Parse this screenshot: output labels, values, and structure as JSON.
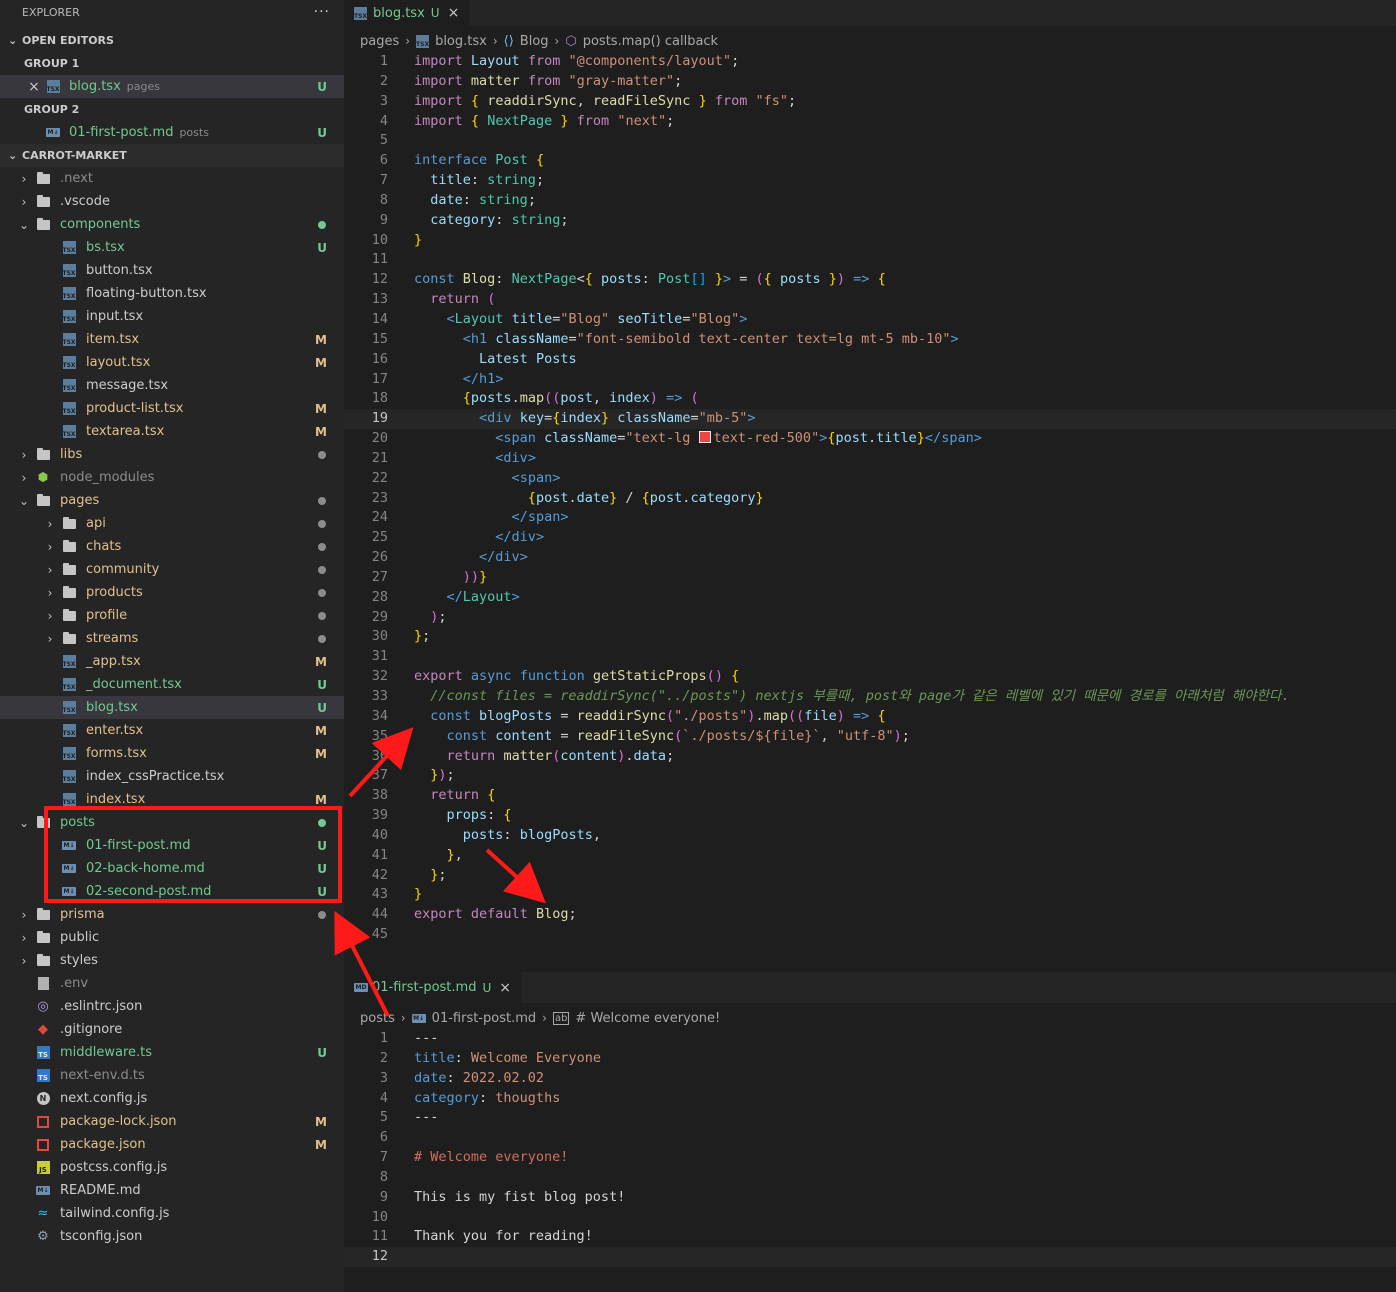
{
  "explorer": {
    "title": "EXPLORER",
    "more": "···",
    "open_editors": {
      "label": "OPEN EDITORS",
      "groups": [
        {
          "label": "GROUP 1",
          "file": "blog.tsx",
          "folder": "pages",
          "status": "U",
          "close": "×"
        },
        {
          "label": "GROUP 2",
          "file": "01-first-post.md",
          "folder": "posts",
          "status": "U"
        }
      ]
    },
    "project": {
      "label": "CARROT-MARKET"
    },
    "tree": [
      {
        "name": ".next",
        "kind": "folder",
        "depth": 0,
        "open": false,
        "color": "dim"
      },
      {
        "name": ".vscode",
        "kind": "folder",
        "depth": 0,
        "open": false,
        "color": "normal"
      },
      {
        "name": "components",
        "kind": "folder",
        "depth": 0,
        "open": true,
        "color": "u",
        "dot": "#73c991"
      },
      {
        "name": "bs.tsx",
        "kind": "tsx",
        "depth": 1,
        "color": "u",
        "status": "U"
      },
      {
        "name": "button.tsx",
        "kind": "tsx",
        "depth": 1,
        "color": "normal"
      },
      {
        "name": "floating-button.tsx",
        "kind": "tsx",
        "depth": 1,
        "color": "normal"
      },
      {
        "name": "input.tsx",
        "kind": "tsx",
        "depth": 1,
        "color": "normal"
      },
      {
        "name": "item.tsx",
        "kind": "tsx",
        "depth": 1,
        "color": "m",
        "status": "M"
      },
      {
        "name": "layout.tsx",
        "kind": "tsx",
        "depth": 1,
        "color": "m",
        "status": "M"
      },
      {
        "name": "message.tsx",
        "kind": "tsx",
        "depth": 1,
        "color": "normal"
      },
      {
        "name": "product-list.tsx",
        "kind": "tsx",
        "depth": 1,
        "color": "m",
        "status": "M"
      },
      {
        "name": "textarea.tsx",
        "kind": "tsx",
        "depth": 1,
        "color": "m",
        "status": "M"
      },
      {
        "name": "libs",
        "kind": "folder",
        "depth": 0,
        "open": false,
        "color": "m",
        "dot": "#8c8c8c"
      },
      {
        "name": "node_modules",
        "kind": "nodefolder",
        "depth": 0,
        "open": false,
        "color": "dim"
      },
      {
        "name": "pages",
        "kind": "folder",
        "depth": 0,
        "open": true,
        "color": "m",
        "dot": "#8c8c8c"
      },
      {
        "name": "api",
        "kind": "folder",
        "depth": 1,
        "open": false,
        "color": "m",
        "dot": "#8c8c8c"
      },
      {
        "name": "chats",
        "kind": "folder",
        "depth": 1,
        "open": false,
        "color": "m",
        "dot": "#8c8c8c"
      },
      {
        "name": "community",
        "kind": "folder",
        "depth": 1,
        "open": false,
        "color": "m",
        "dot": "#8c8c8c"
      },
      {
        "name": "products",
        "kind": "folder",
        "depth": 1,
        "open": false,
        "color": "m",
        "dot": "#8c8c8c"
      },
      {
        "name": "profile",
        "kind": "folder",
        "depth": 1,
        "open": false,
        "color": "m",
        "dot": "#8c8c8c"
      },
      {
        "name": "streams",
        "kind": "folder",
        "depth": 1,
        "open": false,
        "color": "m",
        "dot": "#8c8c8c"
      },
      {
        "name": "_app.tsx",
        "kind": "tsx",
        "depth": 1,
        "color": "m",
        "status": "M"
      },
      {
        "name": "_document.tsx",
        "kind": "tsx",
        "depth": 1,
        "color": "u",
        "status": "U"
      },
      {
        "name": "blog.tsx",
        "kind": "tsx",
        "depth": 1,
        "color": "u",
        "status": "U",
        "selected": true
      },
      {
        "name": "enter.tsx",
        "kind": "tsx",
        "depth": 1,
        "color": "m",
        "status": "M"
      },
      {
        "name": "forms.tsx",
        "kind": "tsx",
        "depth": 1,
        "color": "m",
        "status": "M"
      },
      {
        "name": "index_cssPractice.tsx",
        "kind": "tsx",
        "depth": 1,
        "color": "normal"
      },
      {
        "name": "index.tsx",
        "kind": "tsx",
        "depth": 1,
        "color": "m",
        "status": "M"
      },
      {
        "name": "posts",
        "kind": "folder",
        "depth": 0,
        "open": true,
        "color": "u",
        "dot": "#73c991"
      },
      {
        "name": "01-first-post.md",
        "kind": "md",
        "depth": 1,
        "color": "u",
        "status": "U"
      },
      {
        "name": "02-back-home.md",
        "kind": "md",
        "depth": 1,
        "color": "u",
        "status": "U"
      },
      {
        "name": "02-second-post.md",
        "kind": "md",
        "depth": 1,
        "color": "u",
        "status": "U"
      },
      {
        "name": "prisma",
        "kind": "folder",
        "depth": 0,
        "open": false,
        "color": "m",
        "dot": "#8c8c8c"
      },
      {
        "name": "public",
        "kind": "folder",
        "depth": 0,
        "open": false,
        "color": "normal"
      },
      {
        "name": "styles",
        "kind": "folder",
        "depth": 0,
        "open": false,
        "color": "normal"
      },
      {
        "name": ".env",
        "kind": "doc",
        "depth": 0,
        "color": "dim"
      },
      {
        "name": ".eslintrc.json",
        "kind": "eslint",
        "depth": 0,
        "color": "normal"
      },
      {
        "name": ".gitignore",
        "kind": "git",
        "depth": 0,
        "color": "normal"
      },
      {
        "name": "middleware.ts",
        "kind": "ts",
        "depth": 0,
        "color": "u",
        "status": "U"
      },
      {
        "name": "next-env.d.ts",
        "kind": "ts",
        "depth": 0,
        "color": "dim"
      },
      {
        "name": "next.config.js",
        "kind": "next",
        "depth": 0,
        "color": "normal"
      },
      {
        "name": "package-lock.json",
        "kind": "pkg",
        "depth": 0,
        "color": "m",
        "status": "M"
      },
      {
        "name": "package.json",
        "kind": "pkg",
        "depth": 0,
        "color": "m",
        "status": "M"
      },
      {
        "name": "postcss.config.js",
        "kind": "js",
        "depth": 0,
        "color": "normal"
      },
      {
        "name": "README.md",
        "kind": "md",
        "depth": 0,
        "color": "normal"
      },
      {
        "name": "tailwind.config.js",
        "kind": "tailwind",
        "depth": 0,
        "color": "normal"
      },
      {
        "name": "tsconfig.json",
        "kind": "tsconfig",
        "depth": 0,
        "color": "normal"
      }
    ]
  },
  "editor1": {
    "tab": {
      "name": "blog.tsx",
      "flag": "U",
      "close": "×",
      "icon": "TSX"
    },
    "breadcrumb": [
      "pages",
      "blog.tsx",
      "Blog",
      "posts.map() callback"
    ],
    "active_line": 19,
    "lines": [
      "import Layout from \"@components/layout\";",
      "import matter from \"gray-matter\";",
      "import { readdirSync, readFileSync } from \"fs\";",
      "import { NextPage } from \"next\";",
      "",
      "interface Post {",
      "  title: string;",
      "  date: string;",
      "  category: string;",
      "}",
      "",
      "const Blog: NextPage<{ posts: Post[] }> = ({ posts }) => {",
      "  return (",
      "    <Layout title=\"Blog\" seoTitle=\"Blog\">",
      "      <h1 className=\"font-semibold text-center text=lg mt-5 mb-10\">",
      "        Latest Posts",
      "      </h1>",
      "      {posts.map((post, index) => (",
      "        <div key={index} className=\"mb-5\">",
      "          <span className=\"text-lg text-red-500\">{post.title}</span>",
      "          <div>",
      "            <span>",
      "              {post.date} / {post.category}",
      "            </span>",
      "          </div>",
      "        </div>",
      "      ))}",
      "    </Layout>",
      "  );",
      "};",
      "",
      "export async function getStaticProps() {",
      "  //const files = readdirSync(\"../posts\") nextjs 부를때, post와 page가 같은 레벨에 있기 때문에 경로를 아래처럼 해야한다.",
      "  const blogPosts = readdirSync(\"./posts\").map((file) => {",
      "    const content = readFileSync(`./posts/${file}`, \"utf-8\");",
      "    return matter(content).data;",
      "  });",
      "  return {",
      "    props: {",
      "      posts: blogPosts,",
      "    },",
      "  };",
      "}",
      "export default Blog;",
      ""
    ]
  },
  "editor2": {
    "tab": {
      "name": "01-first-post.md",
      "flag": "U",
      "close": "×",
      "icon": "MD"
    },
    "breadcrumb": [
      "posts",
      "01-first-post.md",
      "# Welcome everyone!"
    ],
    "active_line": 12,
    "lines": [
      "---",
      "title: Welcome Everyone",
      "date: 2022.02.02",
      "category: thougths",
      "---",
      "",
      "# Welcome everyone!",
      "",
      "This is my fist blog post!",
      "",
      "Thank you for reading!",
      ""
    ]
  },
  "colors": {
    "untracked": "#73c991",
    "modified": "#e2c08d",
    "annotation": "#ff1a1a",
    "selection": "#37373d"
  }
}
